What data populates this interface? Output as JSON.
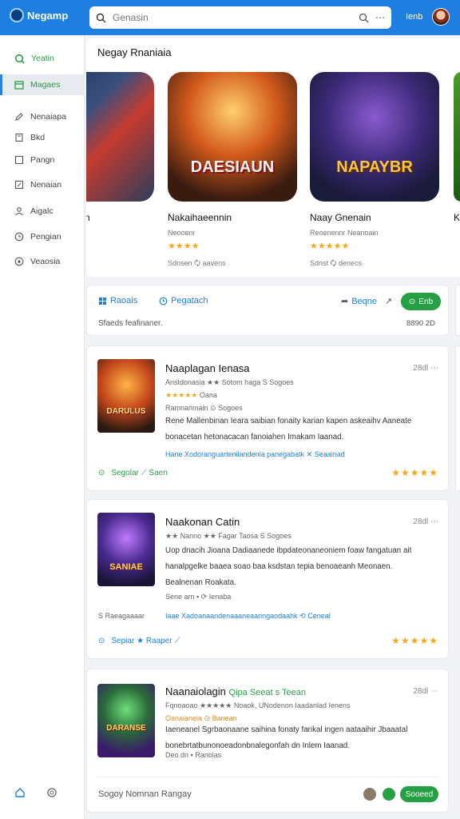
{
  "topbar": {
    "app_name": "Negamp",
    "search_placeholder": "Genasin",
    "right_label": "Ienb"
  },
  "sidebar": {
    "items": [
      {
        "label": "Yeatin",
        "icon": "search-icon"
      },
      {
        "label": "Magaes",
        "icon": "calendar-icon"
      },
      {
        "label": "Nenaiapa",
        "icon": "pen-icon"
      },
      {
        "label": "Bkd",
        "icon": "book-icon"
      },
      {
        "label": "Pangn",
        "icon": "square-icon"
      },
      {
        "label": "Nenaian",
        "icon": "edit-square-icon"
      },
      {
        "label": "Aigalc",
        "icon": "user-icon"
      },
      {
        "label": "Pengian",
        "icon": "clock-icon"
      },
      {
        "label": "Veaosia",
        "icon": "gear-icon"
      }
    ],
    "bottom_icons": [
      "home-icon",
      "settings-icon"
    ]
  },
  "featured": {
    "title": "Negay Rnaniaia",
    "partial_left_label": "n",
    "tiles": [
      {
        "title": "Nakaihaeennin",
        "sub": "Neooenr",
        "stars": "★★★★",
        "meta": "Sdnsen  🗘  aavens",
        "art": "DAESIAUN"
      },
      {
        "title": "Naay Gnenain",
        "sub": "Reoenennr Neanoain",
        "stars": "★★★★★",
        "meta": "Sdnst  🗘  denecs",
        "art": "NAPAYBR"
      }
    ],
    "partial_right_label": "K"
  },
  "share": {
    "link1": "Raoais",
    "link2": "Pegatach",
    "link3": "Beqne",
    "button": "Enb",
    "description": "Sfaeds feafinaner.",
    "count": "8890  2D"
  },
  "cards": [
    {
      "title": "Naaplagan Ienasa",
      "time": "28dl",
      "meta1": "Anstdonasia ★★ Sotom haga  S Sogoes",
      "meta2_stars": "★★★★★",
      "meta2": "Oana",
      "meta3": "Ramnanmain  ⊙  Sogoes",
      "body": "Rene Mallenbinan Ieara saibian fonaity karian kapen askeaihv Aaneate bonacetan hetonacacan fanoiahen Imakam Iaanad.",
      "link_prefix": "Hane",
      "link": "Xodoranguartenilandenia panegabatk  ✕  Seaainad",
      "actions": "Segolar  ⟋  Saen",
      "rating": "★★★★★",
      "art": "DARULUS"
    },
    {
      "title": "Naakonan Catin",
      "time": "28dl",
      "meta1": "★★ Nanno ★★ Fagar Taosa  S Sogoes",
      "body": "Uop dnacih Jioana Dadiaanede ibpdateonaneoniem foaw fangatuan ait hanalpgelke baaea soao baa ksdstan tepia benoaeanh Meonaen.",
      "extra": "Bealnenan Roakata.",
      "meta4": "Sene arn  ▪  ⟳  Ienaba",
      "link_prefix": "Iaae",
      "link": "Xadoanaandenaaaneaaringaodaahk  ⟲  Ceneal",
      "side_note": "S Raeagaaaar",
      "actions": "Sepiar  ★  Raaper  ⟋",
      "rating": "★★★★★",
      "art": "SANIAE"
    },
    {
      "title": "Naanaiolagin",
      "title_extra": "Qipa Seeat s  Teean",
      "time": "28dl",
      "meta1": "Fqnoaoao ★★★★★ Noaok, UNodenon Iaadanlad Ienens",
      "meta2": "Oanaianeia  ⊙  Banean",
      "body": "Iaeneanel  Sgrbaonaane saihina fonaty farikal ingen aataaihir Jbaaatal bonebrtatbunonoeadonbnalegonfah dn Inlem Iaanad.",
      "meta3": "Deo dn  ▪  Ranolas",
      "reply_placeholder": "Sogoy Nomnan Rangay",
      "reply_button": "Sooeed",
      "art": "DARANSE"
    }
  ]
}
